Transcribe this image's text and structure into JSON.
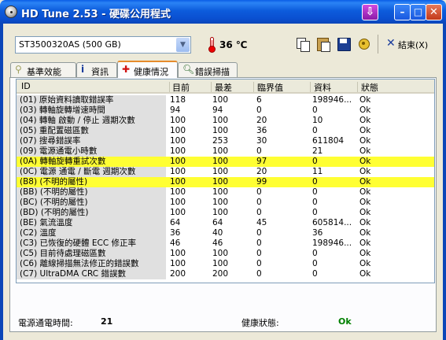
{
  "window": {
    "title": "HD Tune 2.53 - 硬碟公用程式"
  },
  "toolbar": {
    "drive": "ST3500320AS (500 GB)",
    "temperature": "36 ℃",
    "exit_label": "結束(X)"
  },
  "tabs": [
    {
      "label": "基準效能",
      "icon": "benchmark-icon"
    },
    {
      "label": "資訊",
      "icon": "info-icon"
    },
    {
      "label": "健康情況",
      "icon": "health-cross-icon",
      "active": true
    },
    {
      "label": "錯誤掃描",
      "icon": "magnifier-icon"
    }
  ],
  "table": {
    "headers": {
      "id": "ID",
      "current": "目前",
      "worst": "最差",
      "threshold": "臨界值",
      "data": "資料",
      "status": "狀態"
    },
    "rows": [
      {
        "id": "(01) 原始資料讀取錯誤率",
        "current": "118",
        "worst": "100",
        "threshold": "6",
        "data": "198946...",
        "status": "Ok"
      },
      {
        "id": "(03) 轉軸旋轉增速時間",
        "current": "94",
        "worst": "94",
        "threshold": "0",
        "data": "0",
        "status": "Ok"
      },
      {
        "id": "(04) 轉軸 啟動 / 停止 週期次數",
        "current": "100",
        "worst": "100",
        "threshold": "20",
        "data": "10",
        "status": "Ok"
      },
      {
        "id": "(05) 重配置磁區數",
        "current": "100",
        "worst": "100",
        "threshold": "36",
        "data": "0",
        "status": "Ok"
      },
      {
        "id": "(07) 搜尋錯誤率",
        "current": "100",
        "worst": "253",
        "threshold": "30",
        "data": "611804",
        "status": "Ok"
      },
      {
        "id": "(09) 電源通電小時數",
        "current": "100",
        "worst": "100",
        "threshold": "0",
        "data": "21",
        "status": "Ok"
      },
      {
        "id": "(0A) 轉軸旋轉重試次數",
        "current": "100",
        "worst": "100",
        "threshold": "97",
        "data": "0",
        "status": "Ok",
        "highlight": true
      },
      {
        "id": "(0C) 電源 通電 / 斷電 週期次數",
        "current": "100",
        "worst": "100",
        "threshold": "20",
        "data": "11",
        "status": "Ok"
      },
      {
        "id": "(B8) (不明的屬性)",
        "current": "100",
        "worst": "100",
        "threshold": "99",
        "data": "0",
        "status": "Ok",
        "highlight": true
      },
      {
        "id": "(BB) (不明的屬性)",
        "current": "100",
        "worst": "100",
        "threshold": "0",
        "data": "0",
        "status": "Ok"
      },
      {
        "id": "(BC) (不明的屬性)",
        "current": "100",
        "worst": "100",
        "threshold": "0",
        "data": "0",
        "status": "Ok"
      },
      {
        "id": "(BD) (不明的屬性)",
        "current": "100",
        "worst": "100",
        "threshold": "0",
        "data": "0",
        "status": "Ok"
      },
      {
        "id": "(BE) 氣流溫度",
        "current": "64",
        "worst": "64",
        "threshold": "45",
        "data": "605814...",
        "status": "Ok"
      },
      {
        "id": "(C2) 溫度",
        "current": "36",
        "worst": "40",
        "threshold": "0",
        "data": "36",
        "status": "Ok"
      },
      {
        "id": "(C3) 已恢復的硬體 ECC 修正率",
        "current": "46",
        "worst": "46",
        "threshold": "0",
        "data": "198946...",
        "status": "Ok"
      },
      {
        "id": "(C5) 目前待處理磁區數",
        "current": "100",
        "worst": "100",
        "threshold": "0",
        "data": "0",
        "status": "Ok"
      },
      {
        "id": "(C6) 離線掃描無法修正的錯誤數",
        "current": "100",
        "worst": "100",
        "threshold": "0",
        "data": "0",
        "status": "Ok"
      },
      {
        "id": "(C7) UltraDMA CRC 錯誤數",
        "current": "200",
        "worst": "200",
        "threshold": "0",
        "data": "0",
        "status": "Ok"
      }
    ]
  },
  "footer": {
    "hours_label": "電源通電時間:",
    "hours_value": "21",
    "health_label": "健康狀態:",
    "health_value": "Ok"
  },
  "colors": {
    "highlight": "#ffff33",
    "ok_green": "#008000",
    "titlebar": "#0a5ee6"
  }
}
